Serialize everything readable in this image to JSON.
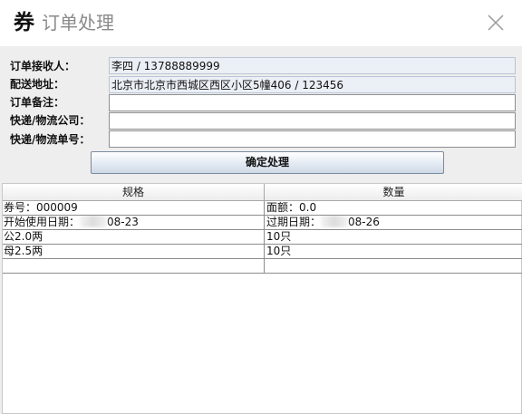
{
  "window": {
    "logo_char": "券",
    "title": "订单处理"
  },
  "form": {
    "recipient_label": "订单接收人：",
    "recipient_value": "李四 / 13788889999",
    "address_label": "配送地址：",
    "address_value": "北京市北京市西城区西区小区5幢406 / 123456",
    "remark_label": "订单备注：",
    "remark_value": "",
    "company_label": "快递/物流公司：",
    "company_value": "",
    "tracking_label": "快递/物流单号：",
    "tracking_value": ""
  },
  "confirm_label": "确定处理",
  "table": {
    "headers": [
      "规格",
      "数量"
    ],
    "rows": [
      {
        "c1": "券号：000009",
        "c2": "面额：0.0"
      },
      {
        "c1a": "开始使用日期：",
        "c1b": "08-23",
        "c2a": "过期日期：",
        "c2b": "08-26"
      },
      {
        "c1": "公2.0两",
        "c2": "10只"
      },
      {
        "c1": "母2.5两",
        "c2": "10只"
      },
      {
        "c1": "",
        "c2": ""
      }
    ]
  },
  "icons": {
    "close": "close-icon"
  },
  "colors": {
    "title": "#8a8a8a",
    "readonly_bg": "#ebeff6",
    "readonly_border": "#b9c4d4"
  }
}
